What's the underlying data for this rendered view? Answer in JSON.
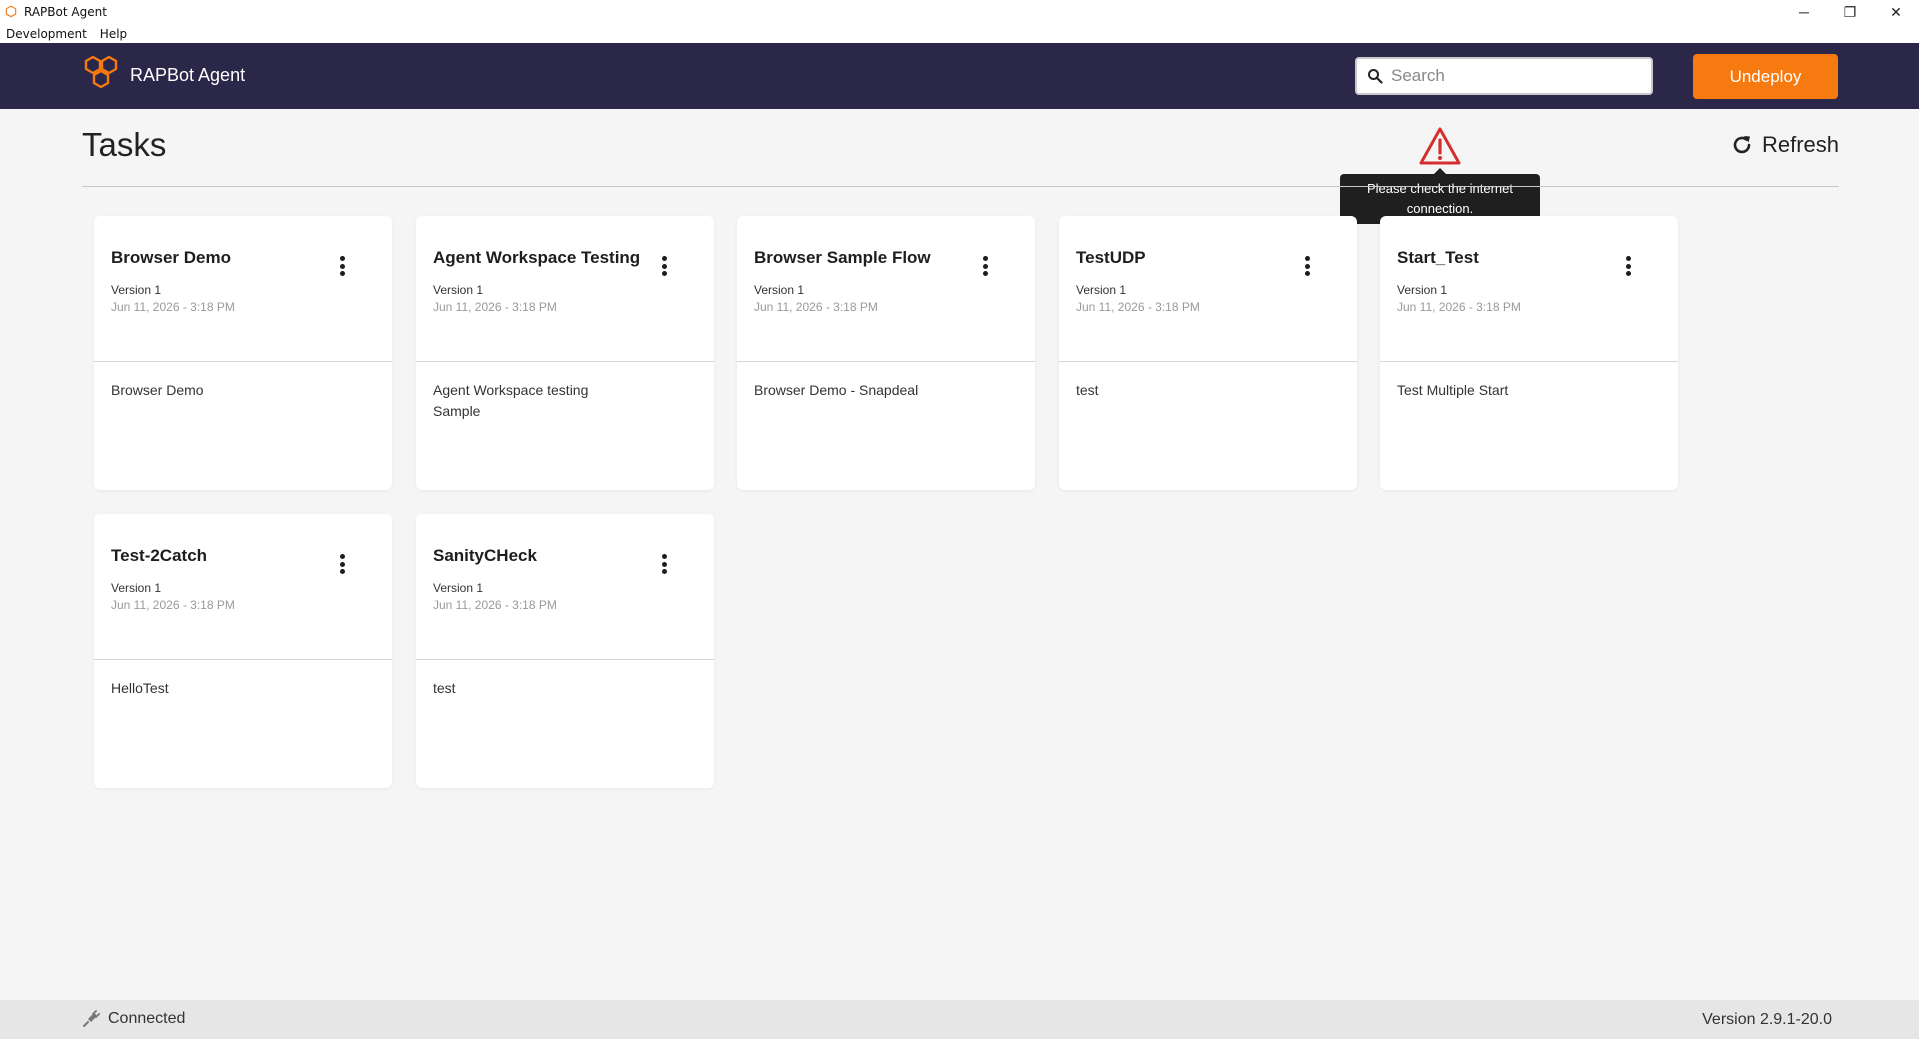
{
  "window": {
    "title": "RAPBot Agent",
    "controls": {
      "minimize": "─",
      "restore": "❐",
      "close": "✕"
    }
  },
  "menu": [
    "Development",
    "Help"
  ],
  "header": {
    "brand": "RAPBot Agent",
    "search_placeholder": "Search",
    "undeploy_label": "Undeploy",
    "accent": "#f77a11",
    "background": "#2b2749"
  },
  "page": {
    "title": "Tasks",
    "refresh_label": "Refresh",
    "warning_tooltip": "Please check the internet connection."
  },
  "tasks": [
    {
      "title": "Browser Demo",
      "version": "Version 1",
      "date": "Jun 11, 2026 - 3:18 PM",
      "description": "Browser Demo"
    },
    {
      "title": "Agent Workspace Testing",
      "version": "Version 1",
      "date": "Jun 11, 2026 - 3:18 PM",
      "description": "Agent Workspace testing Sample"
    },
    {
      "title": "Browser Sample Flow",
      "version": "Version 1",
      "date": "Jun 11, 2026 - 3:18 PM",
      "description": "Browser Demo - Snapdeal"
    },
    {
      "title": "TestUDP",
      "version": "Version 1",
      "date": "Jun 11, 2026 - 3:18 PM",
      "description": "test"
    },
    {
      "title": "Start_Test",
      "version": "Version 1",
      "date": "Jun 11, 2026 - 3:18 PM",
      "description": "Test Multiple Start"
    },
    {
      "title": "Test-2Catch",
      "version": "Version 1",
      "date": "Jun 11, 2026 - 3:18 PM",
      "description": "HelloTest"
    },
    {
      "title": "SanityCHeck",
      "version": "Version 1",
      "date": "Jun 11, 2026 - 3:18 PM",
      "description": "test"
    }
  ],
  "status": {
    "connection": "Connected",
    "version": "Version 2.9.1-20.0"
  },
  "icons": {
    "app": "hexagon-logo-icon",
    "search": "search-icon",
    "refresh": "refresh-icon",
    "warning": "warning-triangle-icon",
    "menu": "kebab-menu-icon",
    "connection": "plug-icon"
  }
}
